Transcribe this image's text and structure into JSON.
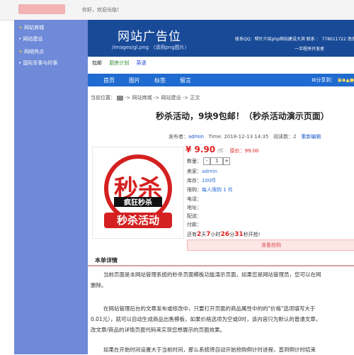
{
  "header": {
    "greeting": "你好，欢迎光临！"
  },
  "sidebar": {
    "items": [
      {
        "label": "网站商城",
        "marker": "+"
      },
      {
        "label": "网站建设",
        "marker": "•"
      },
      {
        "label": "网络热点",
        "marker": "+"
      },
      {
        "label": "国际军事与时事",
        "marker": "•"
      }
    ]
  },
  "banner": {
    "title": "网站广告位",
    "subtitle": "/images/gl.png （请用png图片）",
    "contact": "联系QQ：帮忙介绍php网站建设大滨  联系 ： 778011722 南南",
    "note": "一半程序开发者"
  },
  "links": [
    "包邮",
    "厨房计划",
    "英语"
  ],
  "nav": {
    "items": [
      "首页",
      "图片",
      "标签",
      "留言"
    ],
    "share": "分享到："
  },
  "breadcrumb": {
    "prefix": "当前位置：",
    "items": [
      "网站商城",
      "网站建设",
      "正文"
    ],
    "sep": "->"
  },
  "article": {
    "title": "秒杀活动，9块9包邮！（秒杀活动演示页面）",
    "publisher_label": "发布者：",
    "publisher": "admin",
    "time": "Time: 2018-12-13 14:35",
    "views_label": "阅读数：",
    "views": "2",
    "reedit": "重新编辑"
  },
  "product": {
    "price": "¥ 9.90",
    "unit": "/件",
    "orig_price": "原价：99.00",
    "qty_label": "数量：",
    "qty": "1",
    "seller_label": "卖家：",
    "seller": "admin",
    "stock_label": "库存：",
    "stock": "100件",
    "limit_label": "限购：",
    "limit": "每人限购 1 件",
    "phone_label": "电话：",
    "address_label": "地址：",
    "ship_label": "配送：",
    "pay_label": "付款：",
    "countdown": {
      "prefix": "还有",
      "days": "2",
      "d": "天",
      "hours": "7",
      "h": "小时",
      "minutes": "26",
      "m": "分",
      "seconds": "31",
      "s": "秒开抢!"
    },
    "buy_button": "准备抢购",
    "image_text": {
      "main": "秒杀",
      "sub": "疯狂秒杀",
      "bottom": "秒杀活动"
    }
  },
  "detail": {
    "tab": "本单详情",
    "paragraphs": [
      "当前页面是本网站管理系统的秒杀页面模板功能演示页面，如果您是网站管理员，您可以在网",
      "删除。",
      "在网站管理后台的文章发布或修改中，只要打开页面的商品属性中的的\"价格\"选项填写大于",
      "0.01元），就可以自动生成商品出售模板，如果价格选项为空或0时，该内容只为默认的普通文章，",
      "改文章/商品的详情页面代码来实现您想展示的页面效果。",
      "如果在开始时间设置大于当前时间，那么系统将自动开始抢购倒计时进程，直到倒计时结束"
    ]
  },
  "colors": {
    "banner": "#184a98",
    "sidebar": "#6e8ad8",
    "nav": "#1f6bd0",
    "price": "#e02020"
  }
}
